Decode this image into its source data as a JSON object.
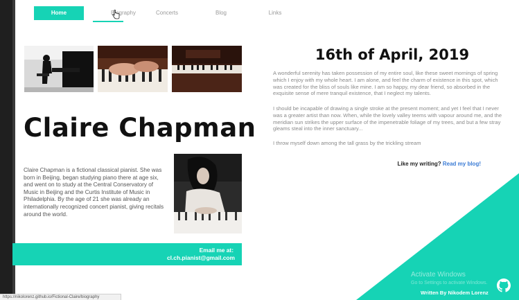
{
  "nav": {
    "items": [
      {
        "label": "Home",
        "active": true
      },
      {
        "label": "Biography",
        "active": false
      },
      {
        "label": "Concerts",
        "active": false
      },
      {
        "label": "Blog",
        "active": false
      },
      {
        "label": "Links",
        "active": false
      }
    ]
  },
  "profile": {
    "name": "Claire Chapman",
    "bio": "Claire Chapman is a fictional classical pianist. She was born in Beijing, began studying piano there at age six, and went on to study at the Central Conservatory of Music in Beijing and the Curtis Institute of Music in Philadelphia. By the age of 21 she was already an internationally recognized concert pianist, giving recitals around the world.",
    "email_label": "Email me at:",
    "email": "cl.ch.pianist@gmail.com"
  },
  "blog": {
    "date": "16th of April, 2019",
    "paragraphs": [
      "A wonderful serenity has taken possession of my entire soul, like these sweet mornings of spring which I enjoy with my whole heart. I am alone, and feel the charm of existence in this spot, which was created for the bliss of souls like mine. I am so happy, my dear friend, so absorbed in the exquisite sense of mere tranquil existence, that I neglect my talents.",
      "I should be incapable of drawing a single stroke at the present moment; and yet I feel that I never was a greater artist than now. When, while the lovely valley teems with vapour around me, and the meridian sun strikes the upper surface of the impenetrable foliage of my trees, and but a few stray gleams steal into the inner sanctuary...",
      "I throw myself down among the tall grass by the trickling stream"
    ],
    "like_prompt": "Like my writing?",
    "like_link": "Read my blog!"
  },
  "footer": {
    "credit": "Written By Nikodem Lorenz",
    "watermark_title": "Activate Windows",
    "watermark_sub": "Go to Settings to activate Windows."
  },
  "status_url": "https://nikolorenz.github.io/Fictional-Claire/biography",
  "colors": {
    "accent": "#16d3b5",
    "link": "#3a7bd5"
  }
}
